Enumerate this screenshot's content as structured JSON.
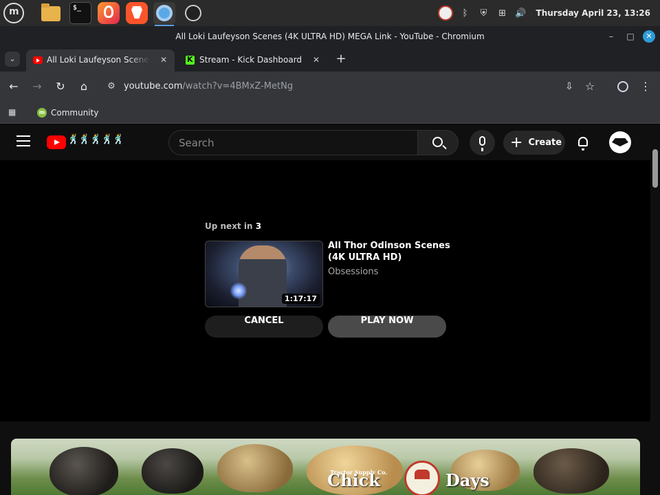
{
  "taskbar": {
    "apps": [
      "mint-menu-icon",
      "files-icon",
      "terminal-icon",
      "firefox-icon",
      "brave-icon",
      "chromium-icon",
      "obs-icon"
    ],
    "terminal_glyph": "$_",
    "clock": "Thursday April 23, 13:26",
    "tray_icons": [
      "obs-tray-icon",
      "bluetooth-icon",
      "shield-icon",
      "network-icon",
      "volume-icon"
    ]
  },
  "window": {
    "title": "All Loki Laufeyson Scenes (4K ULTRA HD) MEGA Link - YouTube - Chromium",
    "buttons": {
      "minimize": "–",
      "maximize": "□",
      "close": "✕"
    }
  },
  "tabs": [
    {
      "title": "All Loki Laufeyson Scenes (4K ULTRA HD) MEGA Link - YouTube",
      "favicon": "youtube-icon",
      "active": true
    },
    {
      "title": "Stream - Kick Dashboard",
      "favicon": "kick-icon",
      "active": false
    }
  ],
  "tab_close_glyph": "✕",
  "new_tab_glyph": "+",
  "toolbar": {
    "url_host": "youtube.com",
    "url_path": "/watch?v=4BMxZ-MetNg"
  },
  "bookmarks": [
    {
      "label": "Community",
      "icon": "linux-mint-icon"
    }
  ],
  "youtube": {
    "logo_doodle": "🕺🕺🕺🕺🕺",
    "search_placeholder": "Search",
    "create_label": "Create",
    "create_icon": "+",
    "up_next": {
      "label": "Up next in",
      "countdown": "3",
      "title": "All Thor Odinson Scenes (4K ULTRA HD)",
      "channel": "Obsessions",
      "duration": "1:17:17",
      "cancel_label": "CANCEL",
      "play_now_label": "PLAY NOW"
    },
    "banner": {
      "brand": "Tractor Supply Co.",
      "headline_left": "Chick",
      "headline_right": "Days"
    }
  },
  "colors": {
    "youtube_red": "#ff0000",
    "kick_green": "#53fc18",
    "chrome_dark": "#202124",
    "toolbar": "#35363a",
    "yt_background": "#0f0f0f"
  }
}
